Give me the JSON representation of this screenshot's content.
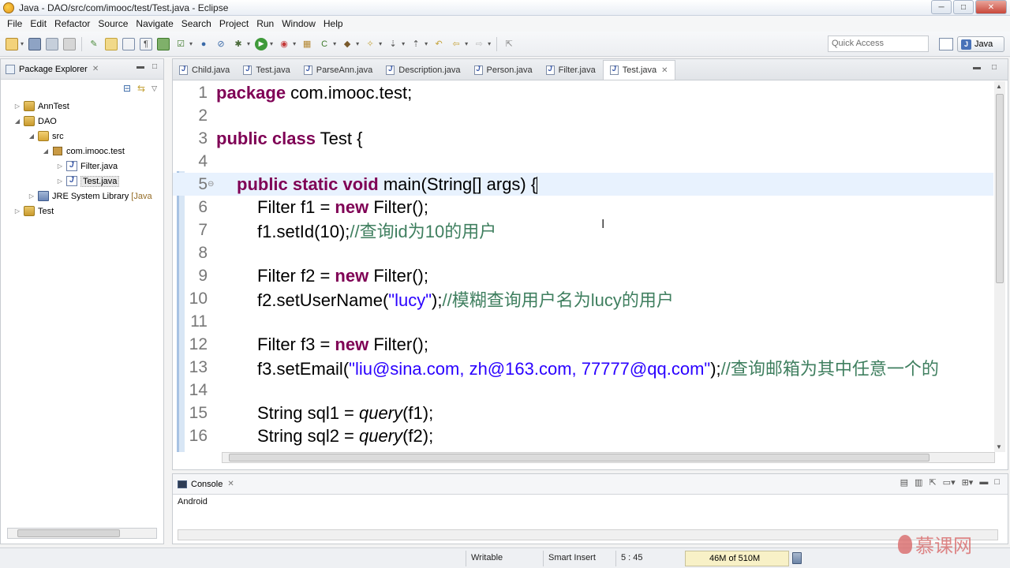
{
  "window": {
    "title": "Java - DAO/src/com/imooc/test/Test.java - Eclipse",
    "controls": {
      "minimize": "─",
      "maximize": "□",
      "close": "✕"
    }
  },
  "menu": [
    "File",
    "Edit",
    "Refactor",
    "Source",
    "Navigate",
    "Search",
    "Project",
    "Run",
    "Window",
    "Help"
  ],
  "toolbar": {
    "quick_access_placeholder": "Quick Access",
    "perspective": "Java"
  },
  "package_explorer": {
    "title": "Package Explorer",
    "nodes": [
      {
        "label": "AnnTest",
        "decor": ""
      },
      {
        "label": "DAO",
        "decor": ""
      },
      {
        "label": "src",
        "decor": ""
      },
      {
        "label": "com.imooc.test",
        "decor": ""
      },
      {
        "label": "Filter.java",
        "decor": ""
      },
      {
        "label": "Test.java",
        "decor": ""
      },
      {
        "label": "JRE System Library",
        "decor": "[Java"
      },
      {
        "label": "Test",
        "decor": ""
      }
    ]
  },
  "editor": {
    "tabs": [
      "Child.java",
      "Test.java",
      "ParseAnn.java",
      "Description.java",
      "Person.java",
      "Filter.java",
      "Test.java"
    ],
    "active_tab_index": 6,
    "line_numbers": [
      "1",
      "2",
      "3",
      "4",
      "5",
      "6",
      "7",
      "8",
      "9",
      "10",
      "11",
      "12",
      "13",
      "14",
      "15",
      "16"
    ],
    "code": {
      "l1_kw": "package",
      "l1_rest": " com.imooc.test;",
      "l3_kw": "public class",
      "l3_rest": " Test {",
      "l5_kw": "public static void",
      "l5_rest": " main(String[] args) {",
      "l6_a": "Filter f1 = ",
      "l6_kw": "new",
      "l6_b": " Filter();",
      "l7_a": "f1.setId(10);",
      "l7_cmt": "//查询id为10的用户",
      "l9_a": "Filter f2 = ",
      "l9_kw": "new",
      "l9_b": " Filter();",
      "l10_a": "f2.setUserName(",
      "l10_str": "\"lucy\"",
      "l10_b": ");",
      "l10_cmt": "//模糊查询用户名为lucy的用户",
      "l12_a": "Filter f3 = ",
      "l12_kw": "new",
      "l12_b": " Filter();",
      "l13_a": "f3.setEmail(",
      "l13_str": "\"liu@sina.com, zh@163.com, 77777@qq.com\"",
      "l13_b": ");",
      "l13_cmt": "//查询邮箱为其中任意一个的",
      "l15_a": "String sql1 = ",
      "l15_it": "query",
      "l15_b": "(f1);",
      "l16_a": "String sql2 = ",
      "l16_it": "query",
      "l16_b": "(f2);"
    }
  },
  "console": {
    "title": "Console",
    "subtitle": "Android"
  },
  "statusbar": {
    "writable": "Writable",
    "insert_mode": "Smart Insert",
    "position": "5 : 45",
    "heap": "46M of 510M"
  },
  "watermark": "慕课网"
}
